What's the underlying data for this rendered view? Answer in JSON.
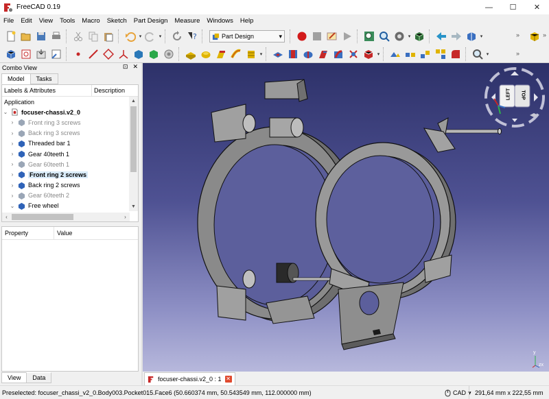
{
  "window": {
    "title": "FreeCAD 0.19",
    "minimize": "—",
    "maximize": "☐",
    "close": "✕"
  },
  "menu": [
    "File",
    "Edit",
    "View",
    "Tools",
    "Macro",
    "Sketch",
    "Part Design",
    "Measure",
    "Windows",
    "Help"
  ],
  "toolbar": {
    "workbench": "Part Design",
    "more": "»"
  },
  "combo_view": {
    "title": "Combo View",
    "controls": [
      "⊡",
      "✕"
    ],
    "tabs": [
      "Model",
      "Tasks"
    ],
    "tree_columns": [
      "Labels & Attributes",
      "Description"
    ],
    "tree_section": "Application",
    "document": "focuser-chassi.v2_0",
    "items": [
      {
        "label": "Front ring 3 screws",
        "state": "hidden"
      },
      {
        "label": "Back ring 3 screws",
        "state": "hidden"
      },
      {
        "label": "Threaded bar 1",
        "state": "visible"
      },
      {
        "label": "Gear 40teeth 1",
        "state": "visible"
      },
      {
        "label": "Gear 60teeth 1",
        "state": "hidden"
      },
      {
        "label": "Front ring 2 screws",
        "state": "selected"
      },
      {
        "label": "Back ring 2 screws",
        "state": "visible"
      },
      {
        "label": "Gear 60teeth 2",
        "state": "hidden"
      },
      {
        "label": "Free wheel",
        "state": "expanded"
      }
    ],
    "property_columns": [
      "Property",
      "Value"
    ],
    "bottom_tabs": [
      "View",
      "Data"
    ]
  },
  "viewport": {
    "navcube": {
      "left": "LEFT",
      "top": "TOP"
    },
    "axis": {
      "y": "y",
      "zx": "zx"
    }
  },
  "document_tab": {
    "label": "focuser-chassi.v2_0 : 1",
    "close": "✕"
  },
  "status": {
    "preselection": "Preselected: focuser_chassi_v2_0.Body003.Pocket015.Face6 (50.660374 mm, 50.543549 mm, 112.000000 mm)",
    "nav_style": "CAD",
    "dimensions": "291,64 mm x 222,55 mm"
  },
  "colors": {
    "accent": "#c62828",
    "viewport_top": "#2d3169",
    "viewport_bottom": "#b7b8dc",
    "selection": "#d9ebf9"
  }
}
